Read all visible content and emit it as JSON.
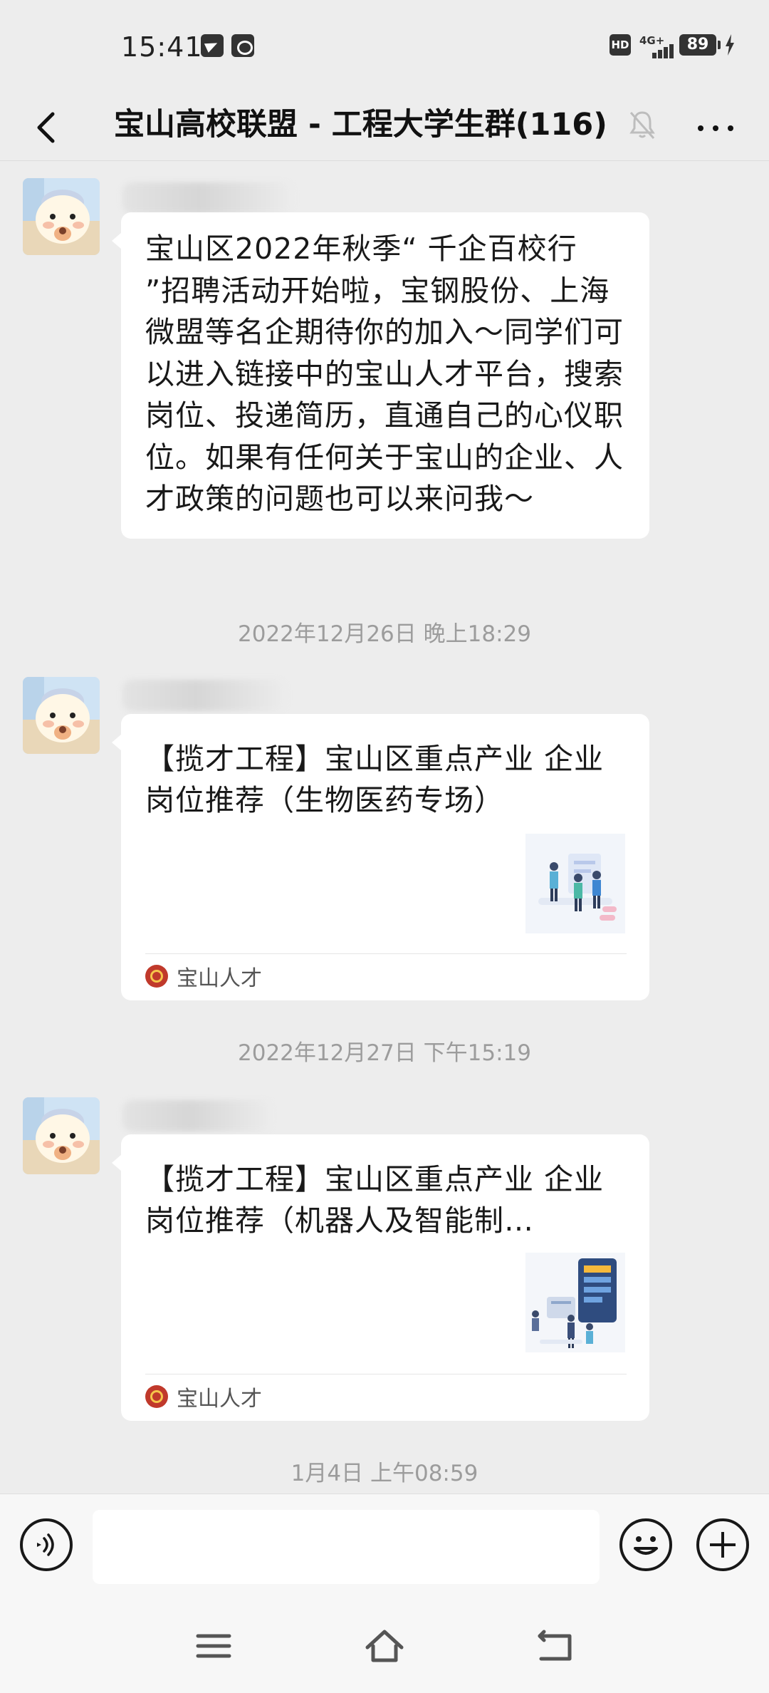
{
  "status_bar": {
    "time": "15:41",
    "hd_label": "HD",
    "network": "4G+",
    "battery": "89",
    "icons": [
      "telegram-icon",
      "app-notification-icon",
      "hd-icon",
      "signal-icon",
      "battery-icon",
      "charging-icon"
    ]
  },
  "header": {
    "title": "宝山高校联盟 - 工程大学生群(116)",
    "back_icon": "chevron-left-icon",
    "mute_icon": "bell-muted-icon",
    "more_icon": "more-dots-icon"
  },
  "messages": [
    {
      "type": "text",
      "text": "宝山区2022年秋季“ 千企百校行 ”招聘活动开始啦，宝钢股份、上海微盟等名企期待你的加入～同学们可以进入链接中的宝山人才平台，搜索岗位、投递简历，直通自己的心仪职位。如果有任何关于宝山的企业、人才政策的问题也可以来问我～"
    },
    {
      "type": "time",
      "text": "2022年12月26日 晚上18:29"
    },
    {
      "type": "card",
      "title": "【揽才工程】宝山区重点产业 企业岗位推荐（生物医药专场）",
      "source": "宝山人才"
    },
    {
      "type": "time",
      "text": "2022年12月27日 下午15:19"
    },
    {
      "type": "card",
      "title": "【揽才工程】宝山区重点产业 企业岗位推荐（机器人及智能制…",
      "source": "宝山人才"
    },
    {
      "type": "time",
      "text": "1月4日 上午08:59"
    }
  ],
  "input_bar": {
    "input_value": "",
    "voice_icon": "voice-icon",
    "emoji_icon": "emoji-icon",
    "plus_icon": "plus-icon"
  },
  "system_nav": {
    "icons": [
      "menu-icon",
      "home-icon",
      "back-icon"
    ]
  },
  "colors": {
    "background": "#ededed",
    "bubble": "#ffffff",
    "timestamp": "#9c9c9c",
    "source_text": "#555555"
  }
}
